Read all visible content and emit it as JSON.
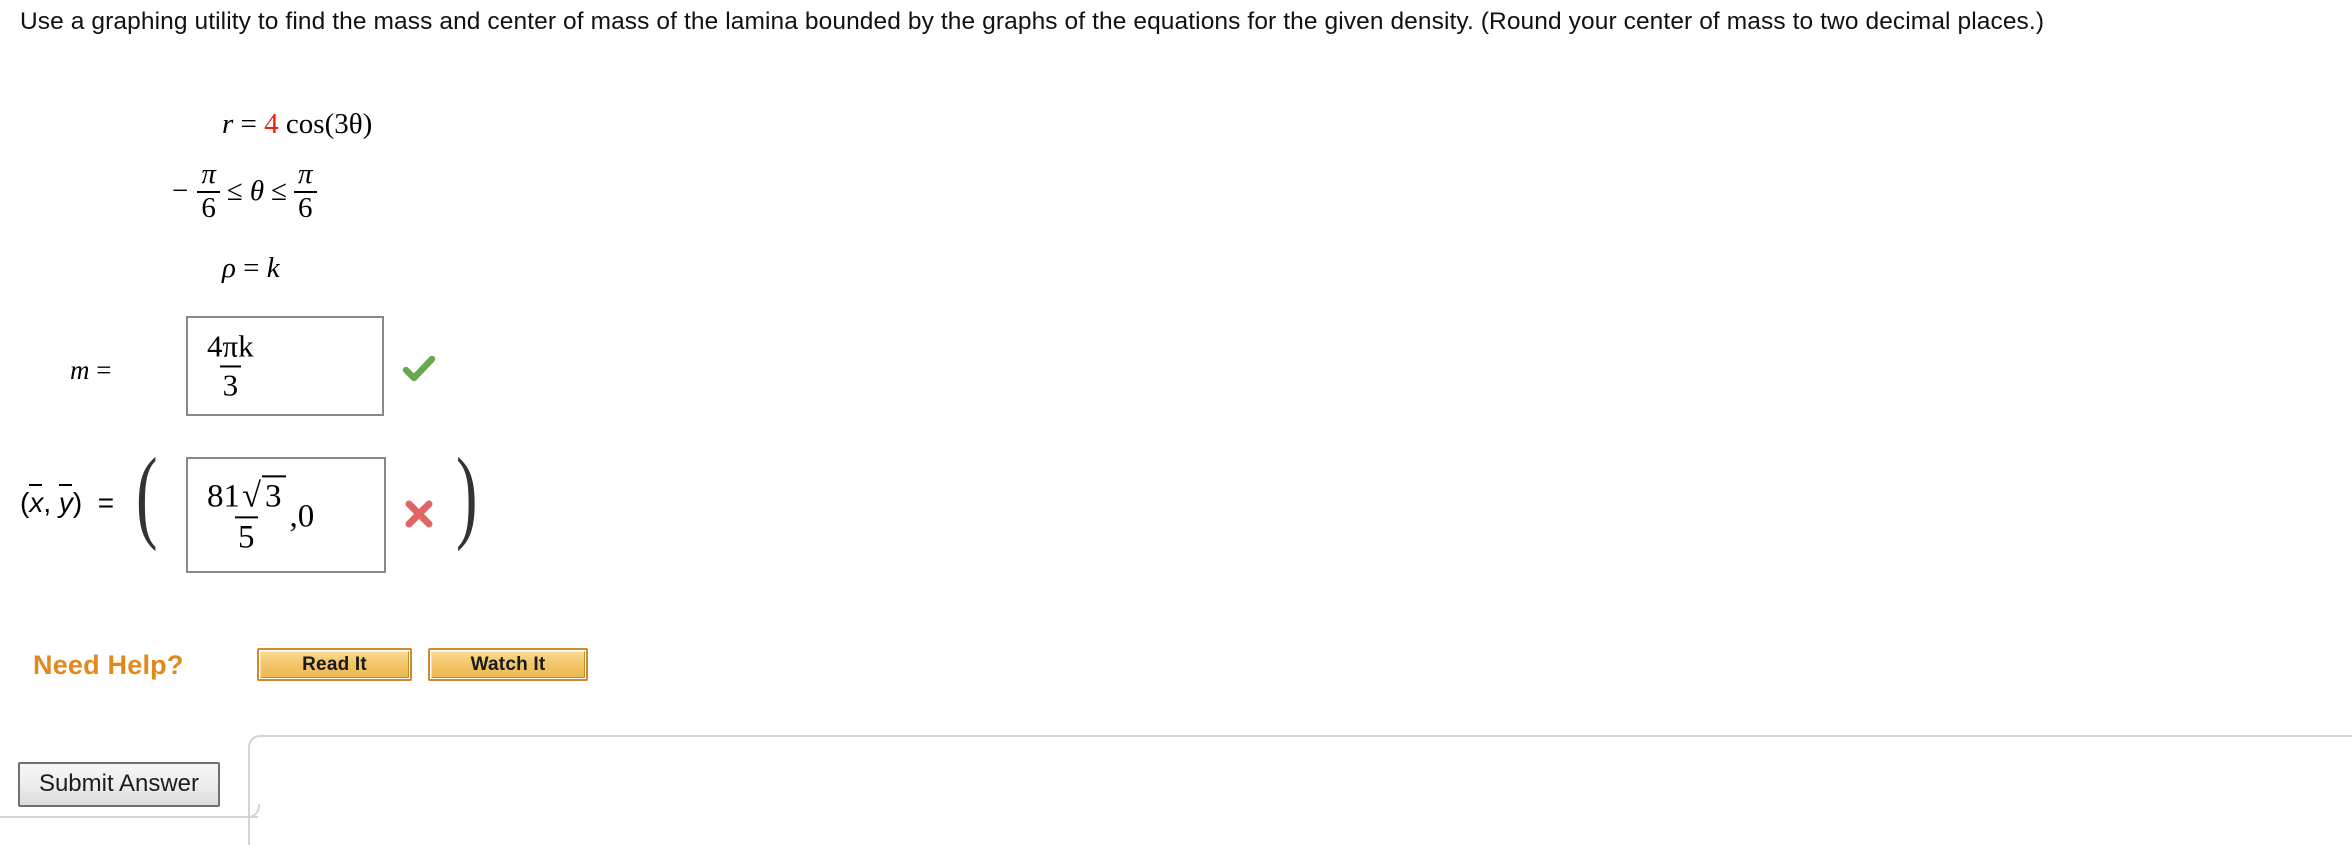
{
  "prompt": {
    "text": "Use a graphing utility to find the mass and center of mass of the lamina bounded by the graphs of the equations for the given density. (Round your center of mass to two decimal places.)"
  },
  "equations": {
    "curve": {
      "lhs": "r",
      "eq": "=",
      "coefficient": "4",
      "coefficient_color": "#e8260c",
      "expression": "cos(3θ)"
    },
    "range": {
      "minus": "−",
      "left_numerator": "π",
      "left_denominator": "6",
      "le1": "≤",
      "variable": "θ",
      "le2": "≤",
      "right_numerator": "π",
      "right_denominator": "6"
    },
    "density": {
      "lhs": "ρ",
      "eq": "=",
      "rhs": "k"
    }
  },
  "answers": {
    "mass": {
      "label": "m",
      "equals": "=",
      "numerator": "4πk",
      "denominator": "3",
      "status": "correct",
      "status_icon": "green-check-icon",
      "status_color": "#6aa84f"
    },
    "center_of_mass": {
      "label_x": "x",
      "label_y": "y",
      "label_comma": ",",
      "label_open": "(",
      "label_close": ")",
      "equals": "=",
      "paren_open": "(",
      "paren_close": ")",
      "numerator_coefficient": "81",
      "numerator_radical": "√",
      "numerator_radicand": "3",
      "denominator": "5",
      "second_component": ",0",
      "status": "incorrect",
      "status_icon": "red-x-icon",
      "status_color": "#e06666"
    }
  },
  "need_help": {
    "label": "Need Help?",
    "label_color": "#e08a1e",
    "buttons": [
      {
        "label": "Read It",
        "name": "read-it"
      },
      {
        "label": "Watch It",
        "name": "watch-it"
      }
    ]
  },
  "footer": {
    "submit_label": "Submit Answer"
  }
}
